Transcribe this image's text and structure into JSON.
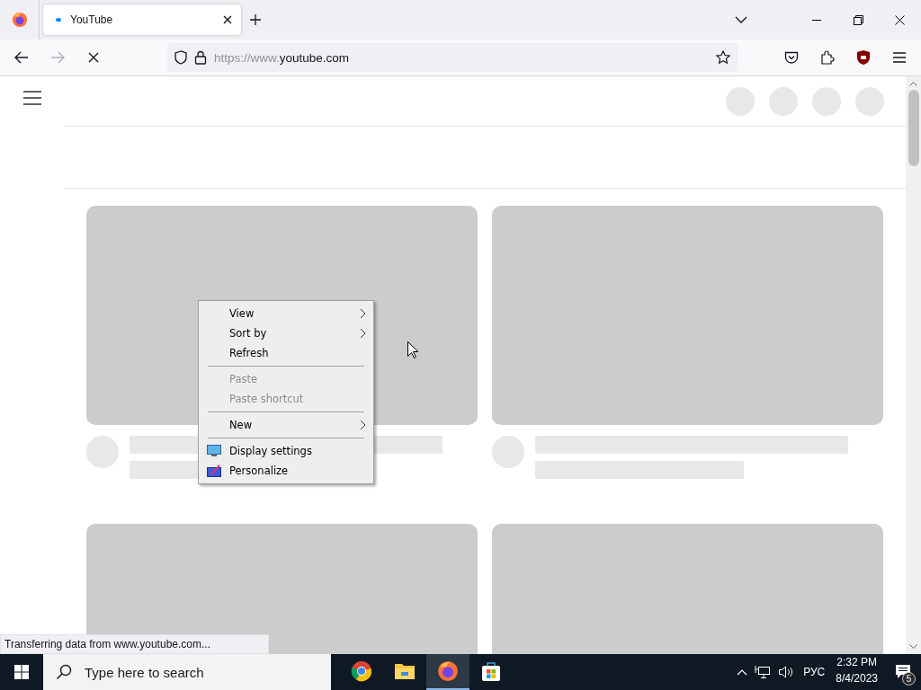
{
  "tabs": [
    {
      "title": "YouTube",
      "selected": true,
      "loading": true
    }
  ],
  "toolbar": {
    "url_prefix": "https://www.",
    "url_host": "youtube.com",
    "loading": true
  },
  "header_placeholders": [
    {
      "kind": "circle"
    },
    {
      "kind": "circle"
    },
    {
      "kind": "circle"
    },
    {
      "kind": "circle"
    }
  ],
  "video_placeholders": [
    {
      "kind": "card"
    },
    {
      "kind": "card"
    },
    {
      "kind": "thumbnail"
    },
    {
      "kind": "thumbnail"
    }
  ],
  "context_menu": [
    {
      "kind": "item",
      "label": "View",
      "disabled": false,
      "submenu": true
    },
    {
      "kind": "item",
      "label": "Sort by",
      "disabled": false,
      "submenu": true
    },
    {
      "kind": "item",
      "label": "Refresh",
      "disabled": false,
      "submenu": false
    },
    {
      "kind": "separator"
    },
    {
      "kind": "item",
      "label": "Paste",
      "disabled": true,
      "submenu": false
    },
    {
      "kind": "item",
      "label": "Paste shortcut",
      "disabled": true,
      "submenu": false
    },
    {
      "kind": "separator"
    },
    {
      "kind": "item",
      "label": "New",
      "disabled": false,
      "submenu": true
    },
    {
      "kind": "separator"
    },
    {
      "kind": "monitor",
      "label": "Display settings",
      "disabled": false,
      "submenu": false
    },
    {
      "kind": "brush",
      "label": "Personalize",
      "disabled": false,
      "submenu": false
    }
  ],
  "status_bar": "Transferring data from www.youtube.com...",
  "taskbar": {
    "search_placeholder": "Type here to search",
    "apps": [
      {
        "kind": "round-browser",
        "selected": false
      },
      {
        "kind": "folder",
        "selected": false
      },
      {
        "kind": "fox-browser",
        "selected": true
      },
      {
        "kind": "bag",
        "selected": false
      }
    ],
    "language": "РУС",
    "time": "2:32 PM",
    "date": "8/4/2023",
    "notifications": "5"
  }
}
